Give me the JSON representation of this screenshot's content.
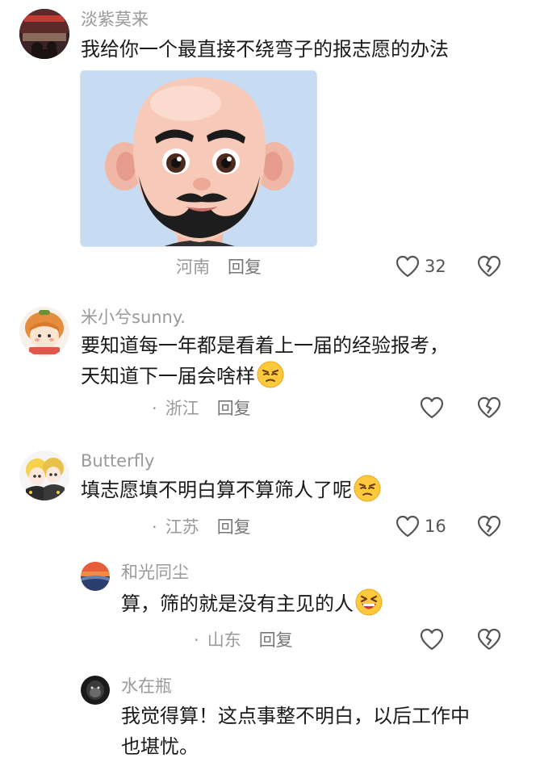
{
  "comments": [
    {
      "username": "淡紫莫来",
      "text": "我给你一个最直接不绕弯子的报志愿的办法",
      "location": "河南",
      "reply_label": "回复",
      "likes": "32",
      "image_icon": "avatar-emoji-bald-man-with-beard"
    },
    {
      "username": "米小兮sunny.",
      "text_line1": "要知道每一年都是看着上一届的经验报考，",
      "text_line2": "天知道下一届会啥样",
      "location": "浙江",
      "reply_label": "回复",
      "likes": "",
      "emoji": "smirk-emoji"
    },
    {
      "username": "Butterfly",
      "text": "填志愿填不明白算不算筛人了呢",
      "location": "江苏",
      "reply_label": "回复",
      "likes": "16",
      "emoji": "smirk-emoji"
    },
    {
      "username": "和光同尘",
      "text": "算，筛的就是没有主见的人",
      "location": "山东",
      "reply_label": "回复",
      "likes": "",
      "emoji": "squinting-laugh-emoji"
    },
    {
      "username": "水在瓶",
      "text_line1": "我觉得算！这点事整不明白，以后工作中",
      "text_line2": "也堪忧。"
    }
  ],
  "dot": "·",
  "icons": {
    "like": "heart-outline-icon",
    "dislike": "broken-heart-icon"
  }
}
